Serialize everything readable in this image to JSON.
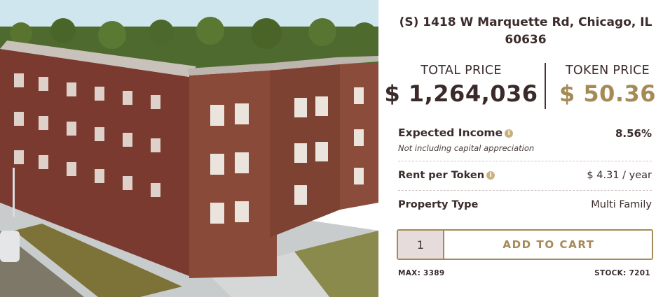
{
  "property": {
    "address": "(S) 1418 W Marquette Rd, Chicago, IL 60636",
    "image_alt": "aerial photo of brick apartment building"
  },
  "prices": {
    "total_label": "TOTAL PRICE",
    "total_value": "$ 1,264,036",
    "token_label": "TOKEN PRICE",
    "token_value": "$ 50.36"
  },
  "details": {
    "expected_income_label": "Expected Income",
    "expected_income_value": "8.56%",
    "expected_income_note": "Not including capital appreciation",
    "rent_label": "Rent per Token",
    "rent_value": "$ 4.31 / year",
    "type_label": "Property Type",
    "type_value": "Multi Family"
  },
  "cart": {
    "quantity": "1",
    "button_label": "ADD TO CART",
    "max_text": "MAX: 3389",
    "stock_text": "STOCK: 7201"
  },
  "icons": {
    "info": "info-icon"
  },
  "colors": {
    "accent_gold": "#a68a56",
    "text_dark": "#3a2a2a",
    "qty_bg": "#e5dcdb"
  }
}
